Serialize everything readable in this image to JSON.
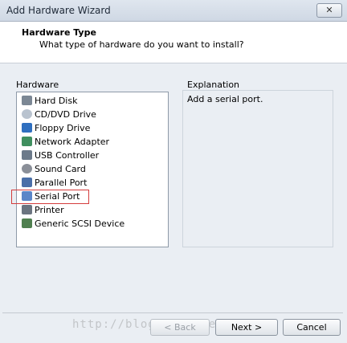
{
  "window": {
    "title": "Add Hardware Wizard",
    "close_glyph": "✕"
  },
  "header": {
    "title": "Hardware Type",
    "subtitle": "What type of hardware do you want to install?"
  },
  "hardware": {
    "label": "Hardware",
    "items": [
      {
        "label": "Hard Disk",
        "icon": "hard-disk-icon",
        "color": "#7b8794"
      },
      {
        "label": "CD/DVD Drive",
        "icon": "cd-dvd-icon",
        "color": "#b9c3cf"
      },
      {
        "label": "Floppy Drive",
        "icon": "floppy-icon",
        "color": "#2f6fbf"
      },
      {
        "label": "Network Adapter",
        "icon": "network-adapter-icon",
        "color": "#3f8f5f"
      },
      {
        "label": "USB Controller",
        "icon": "usb-icon",
        "color": "#6c7a8a"
      },
      {
        "label": "Sound Card",
        "icon": "sound-card-icon",
        "color": "#8a8f98"
      },
      {
        "label": "Parallel Port",
        "icon": "parallel-port-icon",
        "color": "#4a6fa8"
      },
      {
        "label": "Serial Port",
        "icon": "serial-port-icon",
        "color": "#5b86c8"
      },
      {
        "label": "Printer",
        "icon": "printer-icon",
        "color": "#6b7480"
      },
      {
        "label": "Generic SCSI Device",
        "icon": "scsi-device-icon",
        "color": "#4f7f4f"
      }
    ],
    "selected": "Serial Port"
  },
  "explanation": {
    "label": "Explanation",
    "text": "Add a serial port."
  },
  "buttons": {
    "back": {
      "label": "< Back",
      "mnemonic": "B"
    },
    "next": {
      "label": "Next >",
      "mnemonic": "N"
    },
    "cancel": {
      "label": "Cancel"
    }
  },
  "watermark": "http://blog.csdn.net/..."
}
